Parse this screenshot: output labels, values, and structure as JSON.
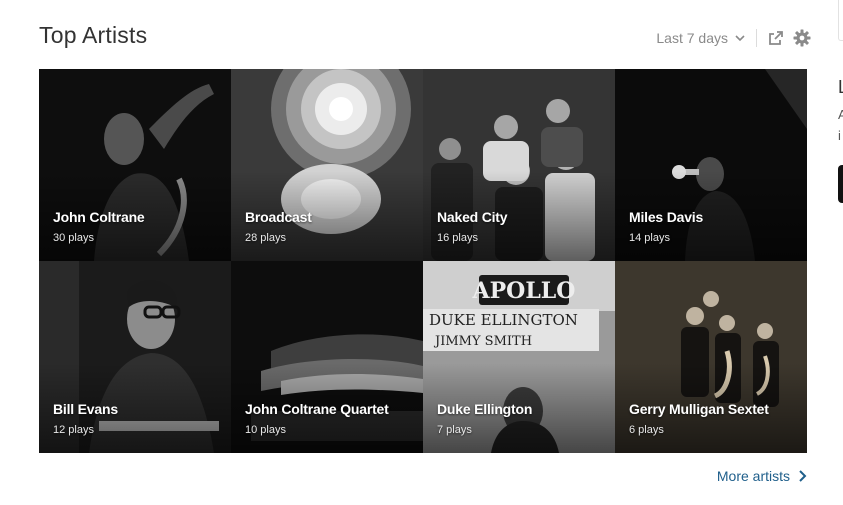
{
  "header": {
    "title": "Top Artists",
    "period_label": "Last 7 days"
  },
  "icons": {
    "period": "chevron-down-icon",
    "share": "share-icon",
    "settings": "gear-icon",
    "more": "chevron-right-icon"
  },
  "artists": [
    {
      "name": "John Coltrane",
      "plays": "30 plays"
    },
    {
      "name": "Broadcast",
      "plays": "28 plays"
    },
    {
      "name": "Naked City",
      "plays": "16 plays"
    },
    {
      "name": "Miles Davis",
      "plays": "14 plays"
    },
    {
      "name": "Bill Evans",
      "plays": "12 plays"
    },
    {
      "name": "John Coltrane Quartet",
      "plays": "10 plays"
    },
    {
      "name": "Duke Ellington",
      "plays": "7 plays"
    },
    {
      "name": "Gerry Mulligan Sextet",
      "plays": "6 plays"
    }
  ],
  "footer": {
    "more_label": "More artists"
  },
  "sidebar_partial": {
    "heading": "L",
    "line1": "A",
    "line2": "i"
  },
  "colors": {
    "link": "#1f5f8b",
    "title": "#333333",
    "muted": "#8a8a8a"
  }
}
